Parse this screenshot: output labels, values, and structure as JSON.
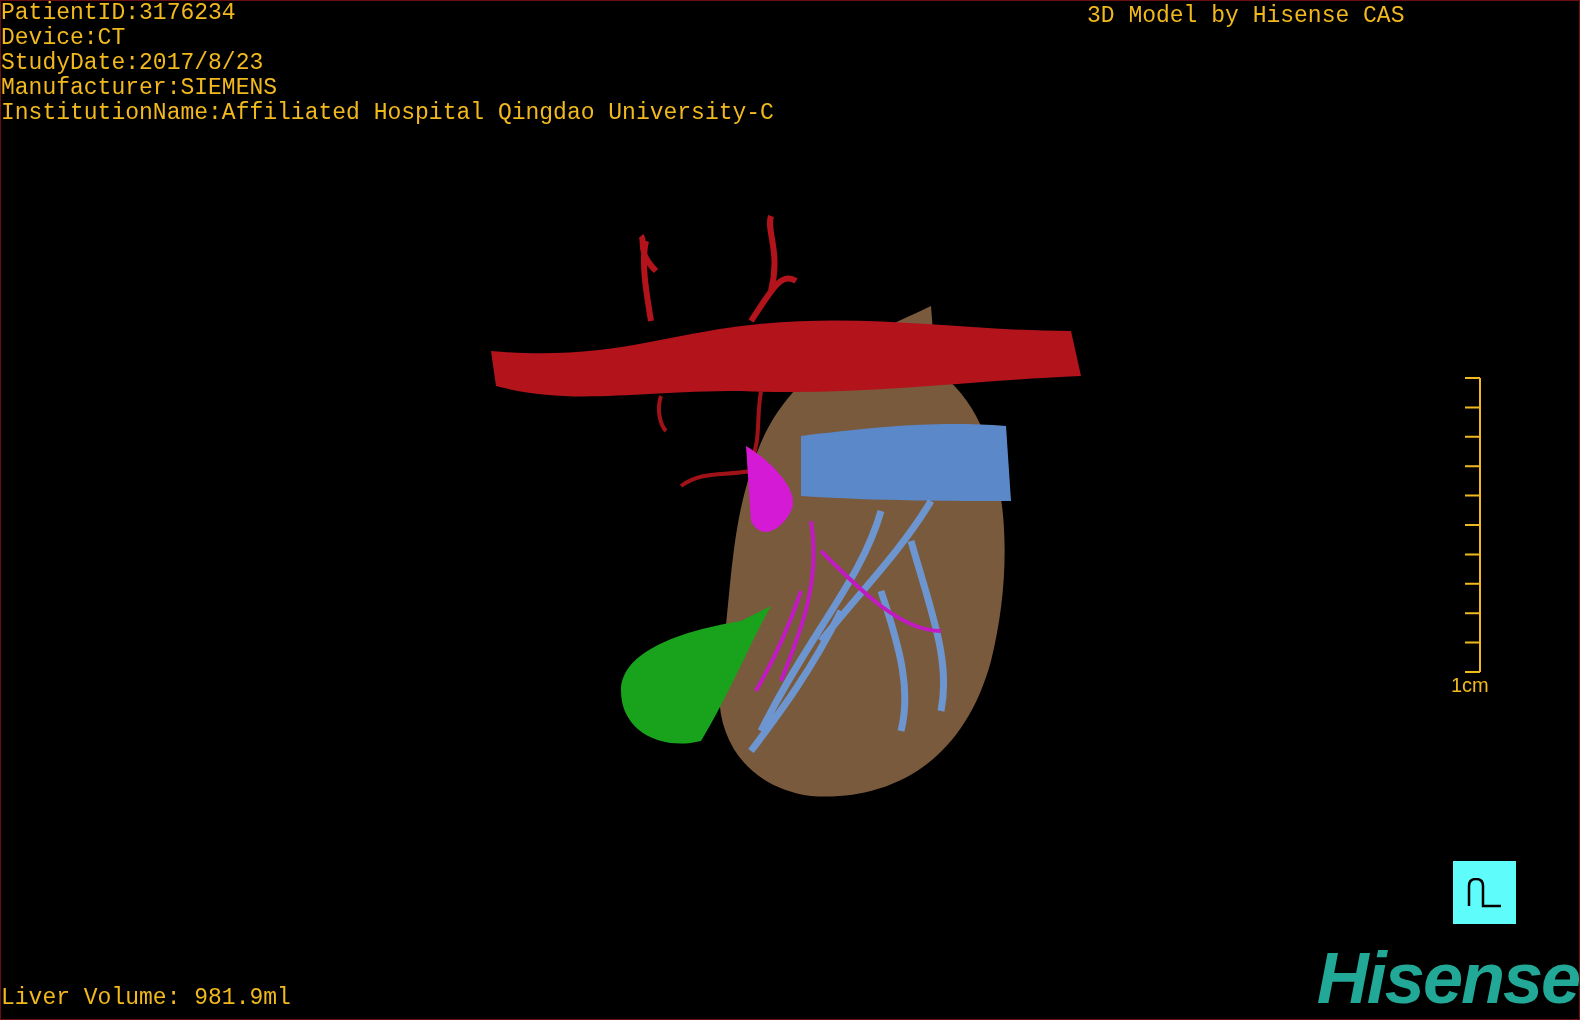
{
  "info_lines": [
    "PatientID:3176234",
    "Device:CT",
    "StudyDate:2017/8/23",
    "Manufacturer:SIEMENS",
    "InstitutionName:Affiliated Hospital Qingdao University-C"
  ],
  "title": "3D Model by Hisense CAS",
  "scale_bar": {
    "label": "1cm"
  },
  "volume": "Liver Volume: 981.9ml",
  "logo": "Hisense"
}
